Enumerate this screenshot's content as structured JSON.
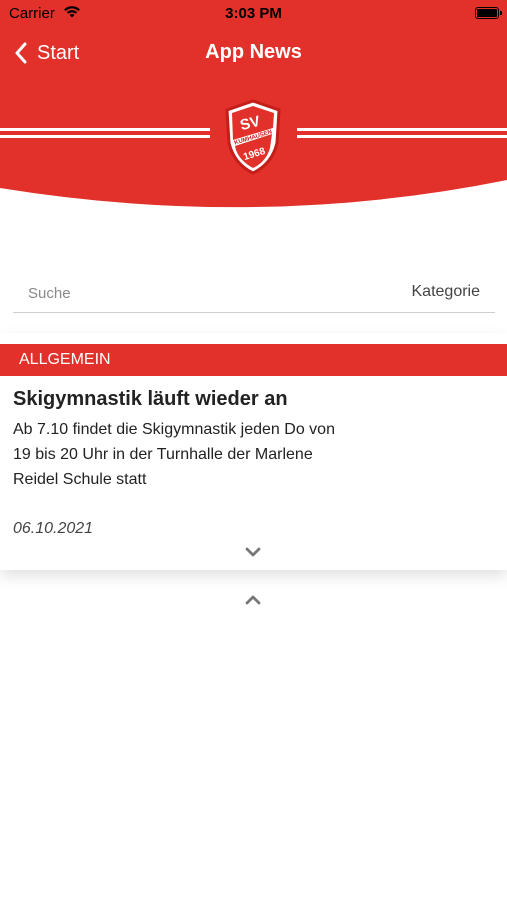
{
  "status_bar": {
    "carrier": "Carrier",
    "time": "3:03 PM"
  },
  "nav": {
    "back_label": "Start",
    "title": "App News"
  },
  "logo": {
    "top_text": "SV",
    "arc_text": "KUMHAUSEN",
    "year": "1968"
  },
  "search": {
    "placeholder": "Suche",
    "value": "",
    "category_label": "Kategorie"
  },
  "news": [
    {
      "category": "ALLGEMEIN",
      "title": "Skigymnastik läuft wieder an",
      "body": "Ab 7.10 findet die Skigymnastik jeden Do von 19 bis 20 Uhr in der Turnhalle der Marlene Reidel Schule statt",
      "date": "06.10.2021"
    }
  ],
  "colors": {
    "brand_red": "#e2302a",
    "background": "#ffffff",
    "text": "#222222",
    "muted": "#8a8a8a"
  }
}
